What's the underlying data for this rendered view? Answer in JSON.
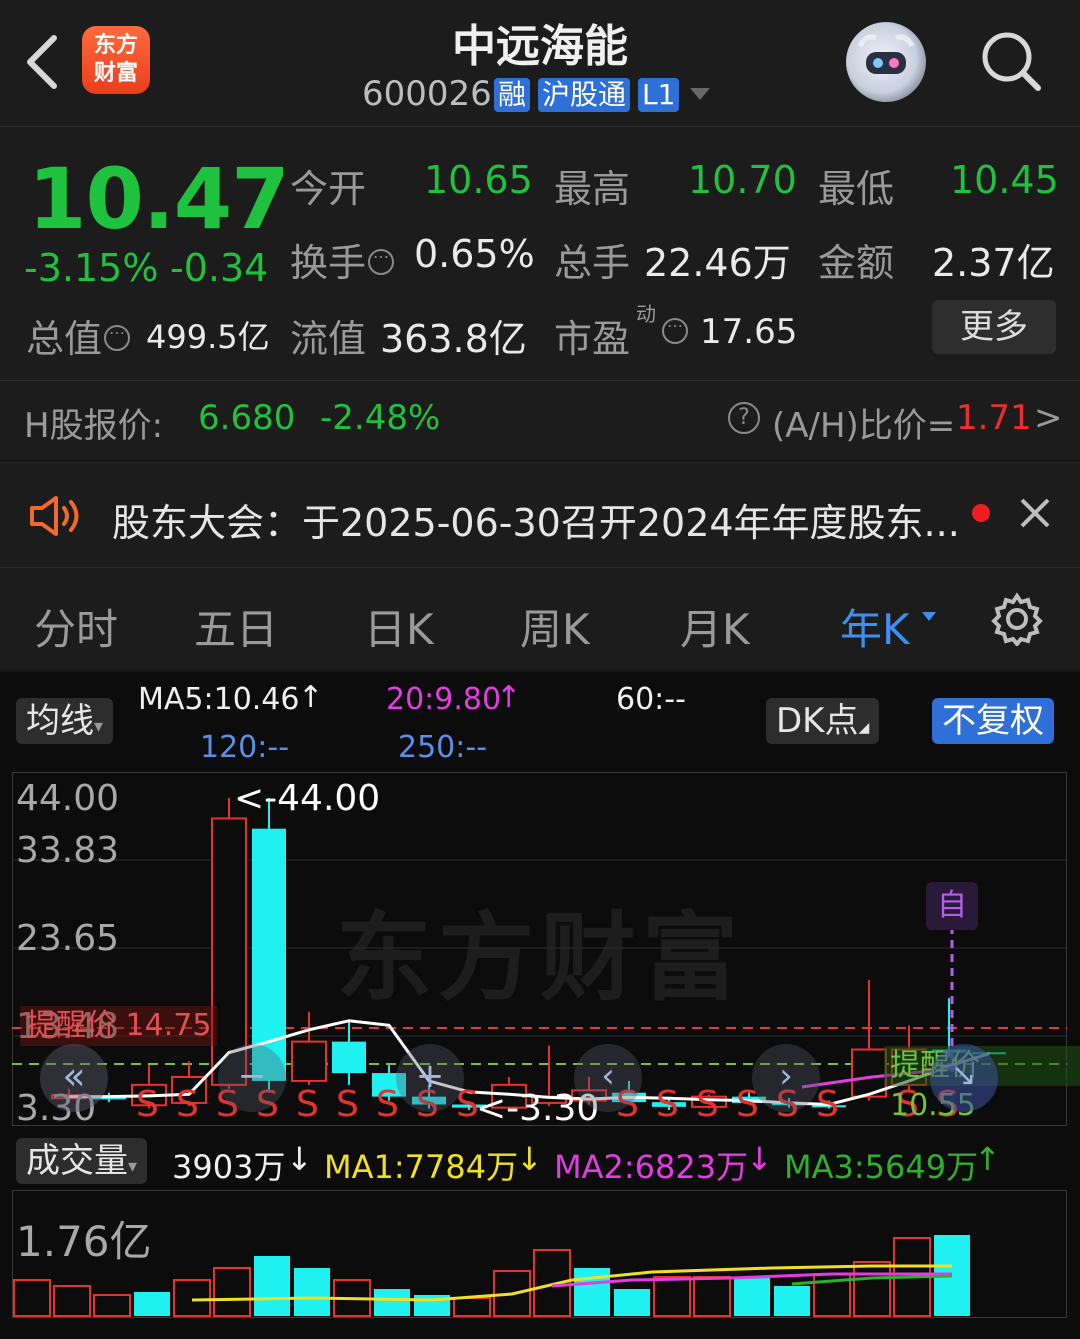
{
  "header": {
    "app_logo_text": [
      "东方",
      "财富"
    ],
    "stock_name": "中远海能",
    "stock_code": "600026",
    "tags": [
      "融",
      "沪股通",
      "L1"
    ]
  },
  "quote": {
    "price": "10.47",
    "change_pct": "-3.15%",
    "change": "-0.34",
    "fields": [
      {
        "label": "今开",
        "value": "10.65"
      },
      {
        "label": "最高",
        "value": "10.70"
      },
      {
        "label": "最低",
        "value": "10.45"
      },
      {
        "label": "换手",
        "value": "0.65%"
      },
      {
        "label": "总手",
        "value": "22.46万"
      },
      {
        "label": "金额",
        "value": "2.37亿"
      },
      {
        "label": "总值",
        "value": "499.5亿"
      },
      {
        "label": "流值",
        "value": "363.8亿"
      },
      {
        "label": "市盈",
        "sup": "动",
        "value": "17.65"
      }
    ],
    "more_label": "更多"
  },
  "hshare": {
    "label": "H股报价:",
    "price": "6.680",
    "change": "-2.48%",
    "ratio_label": "(A/H)比价=",
    "ratio_value": "1.71",
    "arrow": ">"
  },
  "notice": {
    "text": "股东大会：于2025-06-30召开2024年年度股东..."
  },
  "tabs": [
    "分时",
    "五日",
    "日K",
    "周K",
    "月K",
    "年K"
  ],
  "active_tab": "年K",
  "kchart": {
    "ma_button": "均线",
    "ma5": "MA5:10.46",
    "ma20": "20:9.80",
    "ma60": "60:--",
    "ma120": "120:--",
    "ma250": "250:--",
    "dk_button": "DK点",
    "fq_button": "不复权",
    "y_labels": [
      "44.00",
      "33.83",
      "23.65",
      "13.48",
      "3.30"
    ],
    "max_label": "<-44.00",
    "min_label": "<-3.30",
    "alert_left": "提醒价 14.75",
    "alert_right": "提醒价 10.55",
    "self_tag": "自",
    "watermark": "东方财富",
    "s_marker": "S"
  },
  "volume": {
    "button": "成交量",
    "vol": "3903万",
    "ma1": "MA1:7784万",
    "ma2": "MA2:6823万",
    "ma3": "MA3:5649万",
    "max_label": "1.76亿"
  },
  "chart_data": {
    "type": "candlestick",
    "ylim": [
      3.3,
      44.0
    ],
    "candles": [
      {
        "o": 4.8,
        "c": 5.2,
        "h": 6.0,
        "l": 4.2
      },
      {
        "o": 4.9,
        "c": 4.7,
        "h": 5.5,
        "l": 4.3
      },
      {
        "o": 3.9,
        "c": 6.5,
        "h": 9.0,
        "l": 3.5
      },
      {
        "o": 4.2,
        "c": 7.5,
        "h": 9.5,
        "l": 3.8
      },
      {
        "o": 6.5,
        "c": 40.0,
        "h": 44.0,
        "l": 6.0
      },
      {
        "o": 38.0,
        "c": 7.0,
        "h": 44.0,
        "l": 5.5
      },
      {
        "o": 7.0,
        "c": 12.0,
        "h": 15.5,
        "l": 6.5
      },
      {
        "o": 12.0,
        "c": 8.0,
        "h": 14.5,
        "l": 6.5
      },
      {
        "o": 8.0,
        "c": 5.0,
        "h": 9.0,
        "l": 4.5
      },
      {
        "o": 5.0,
        "c": 4.0,
        "h": 6.5,
        "l": 3.5
      },
      {
        "o": 4.0,
        "c": 3.6,
        "h": 4.3,
        "l": 3.3
      },
      {
        "o": 3.6,
        "c": 6.5,
        "h": 7.5,
        "l": 3.4
      },
      {
        "o": 4.2,
        "c": 5.0,
        "h": 11.5,
        "l": 3.8
      },
      {
        "o": 4.5,
        "c": 5.8,
        "h": 7.5,
        "l": 4.0
      },
      {
        "o": 5.5,
        "c": 4.3,
        "h": 7.0,
        "l": 4.0
      },
      {
        "o": 4.3,
        "c": 3.7,
        "h": 4.8,
        "l": 3.3
      },
      {
        "o": 3.7,
        "c": 5.0,
        "h": 5.3,
        "l": 3.5
      },
      {
        "o": 5.0,
        "c": 4.2,
        "h": 5.5,
        "l": 4.0
      },
      {
        "o": 4.2,
        "c": 3.9,
        "h": 4.8,
        "l": 3.6
      },
      {
        "o": 3.9,
        "c": 3.8,
        "h": 4.5,
        "l": 3.5
      },
      {
        "o": 5.0,
        "c": 11.0,
        "h": 19.0,
        "l": 4.5
      },
      {
        "o": 6.5,
        "c": 11.0,
        "h": 14.0,
        "l": 5.5
      },
      {
        "o": 11.0,
        "c": 10.6,
        "h": 17.0,
        "l": 10.0
      },
      {
        "o": 10.65,
        "c": 10.47,
        "h": 10.7,
        "l": 10.45
      }
    ],
    "ma5": [
      5.0,
      5.0,
      5.1,
      5.3,
      10.6,
      12.0,
      13.5,
      14.5,
      14.0,
      7.0,
      5.6,
      5.3,
      4.9,
      4.7,
      4.9,
      4.8,
      4.6,
      4.5,
      4.2,
      4.0,
      5.3,
      7.0,
      8.9,
      10.46
    ]
  }
}
